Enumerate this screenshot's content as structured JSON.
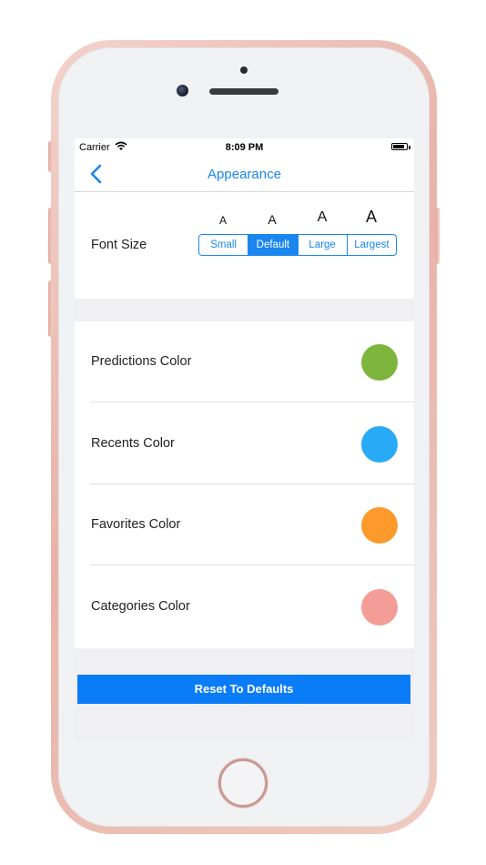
{
  "status_bar": {
    "carrier": "Carrier",
    "time": "8:09 PM"
  },
  "nav": {
    "title": "Appearance",
    "back_icon": "chevron-left-icon"
  },
  "font_size": {
    "label": "Font Size",
    "preview_glyph": "A",
    "options": [
      "Small",
      "Default",
      "Large",
      "Largest"
    ],
    "selected": "Default"
  },
  "colors": {
    "items": [
      {
        "label": "Predictions Color",
        "color": "#7db53d"
      },
      {
        "label": "Recents Color",
        "color": "#29aaf6"
      },
      {
        "label": "Favorites Color",
        "color": "#fc9a2c"
      },
      {
        "label": "Categories Color",
        "color": "#f39d96"
      }
    ]
  },
  "reset_label": "Reset To Defaults",
  "accent_color": "#1a86ee"
}
